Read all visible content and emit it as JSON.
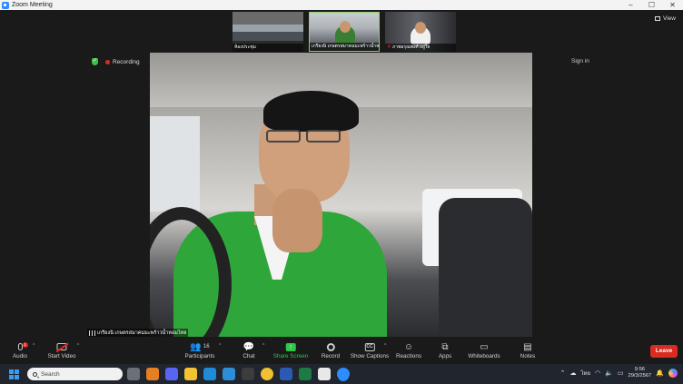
{
  "window": {
    "title": "Zoom Meeting",
    "controls": [
      "–",
      "☐",
      "✕"
    ]
  },
  "thumbnails": [
    {
      "name": "ห้องประชุม",
      "muted": false
    },
    {
      "name": "เกรียงนิ เกษตรสมาคมมะพร้าวน้ำหอมไทย",
      "muted": false
    },
    {
      "name": "ภาพอรุณพงศ์ อยู่ใจ",
      "muted": true
    }
  ],
  "view_button": {
    "label": "View"
  },
  "status": {
    "recording_label": "Recording"
  },
  "sign_in": "Sign in",
  "active_speaker": {
    "name": "เกรียงนิ เกษตรสมาคมมะพร้าวน้ำหอมไทย"
  },
  "toolbar": {
    "audio": "Audio",
    "audio_badge": "1",
    "start_video": "Start Video",
    "participants": "Participants",
    "participants_count": "16",
    "chat": "Chat",
    "share_screen": "Share Screen",
    "record": "Record",
    "show_captions": "Show Captions",
    "reactions": "Reactions",
    "apps": "Apps",
    "whiteboards": "Whiteboards",
    "notes": "Notes",
    "leave": "Leave"
  },
  "taskbar": {
    "search_placeholder": "Search",
    "language": "ไทย",
    "time": "9:56",
    "date": "29/3/2567"
  },
  "colors": {
    "share_green": "#2fc64a",
    "leave_red": "#d82c20",
    "recording_red": "#e02828"
  }
}
